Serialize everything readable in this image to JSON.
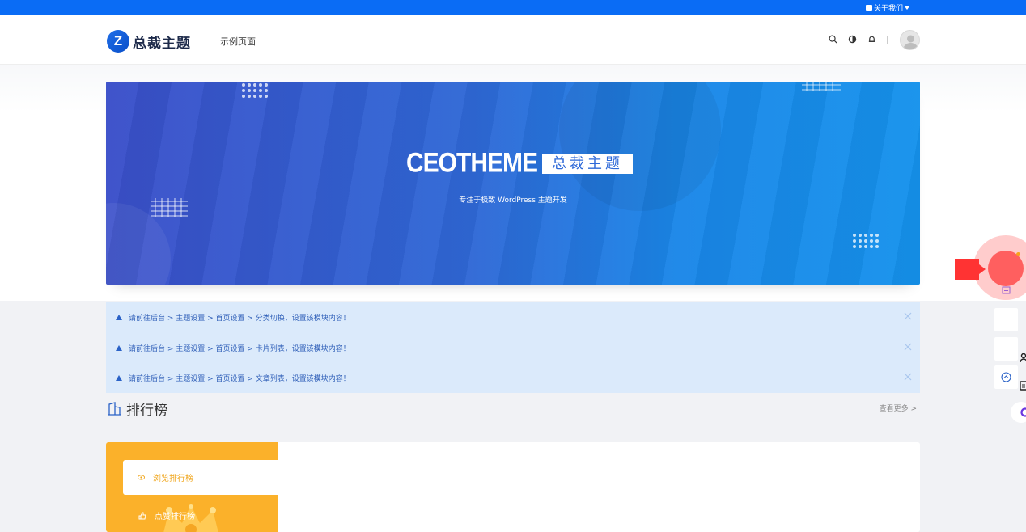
{
  "topbar": {
    "about_label": "关于我们"
  },
  "header": {
    "logo_mark": "Z",
    "logo_text": "总裁主题",
    "nav": [
      "示例页面"
    ],
    "icons": [
      "search-icon",
      "theme-toggle-icon",
      "bell-icon",
      "avatar"
    ]
  },
  "banner": {
    "brand_en": "CEOTHEME",
    "brand_cn": "总裁主题",
    "tagline": "专注于极致 WordPress 主题开发"
  },
  "notices": [
    {
      "text": "请前往后台 > 主题设置 > 首页设置 > 分类切换，设置该模块内容！"
    },
    {
      "text": "请前往后台 > 主题设置 > 首页设置 > 卡片列表，设置该模块内容！"
    },
    {
      "text": "请前往后台 > 主题设置 > 首页设置 > 文章列表，设置该模块内容！"
    }
  ],
  "ranking": {
    "title": "排行榜",
    "more": "查看更多 >",
    "tabs": [
      {
        "label": "浏览排行榜",
        "active": true
      },
      {
        "label": "点赞排行榜",
        "active": false
      }
    ]
  },
  "colors": {
    "topbar": "#0a6cf5",
    "banner_start": "#3a4fc9",
    "banner_end": "#1592ec",
    "notice_bg": "#dbeafb",
    "rank_accent": "#fbb12a",
    "float_red": "#ff5f5f"
  }
}
